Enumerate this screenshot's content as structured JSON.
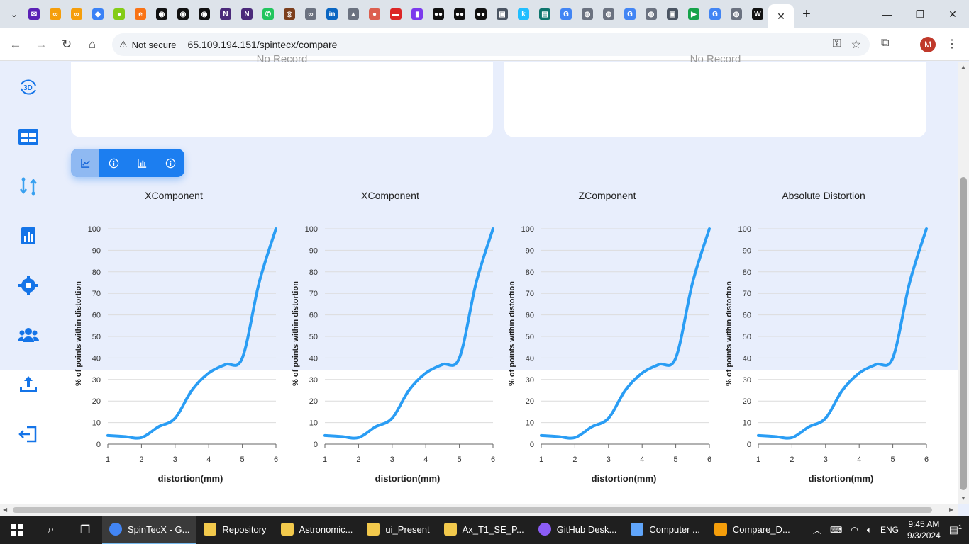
{
  "browser": {
    "tab_favicons": [
      {
        "name": "gmail-icon",
        "color": "#5b21b6",
        "glyph": "✉"
      },
      {
        "name": "infinity-icon",
        "color": "#f59e0b",
        "glyph": "∞"
      },
      {
        "name": "infinity-icon-2",
        "color": "#f59e0b",
        "glyph": "∞"
      },
      {
        "name": "edu-icon",
        "color": "#3b82f6",
        "glyph": "◆"
      },
      {
        "name": "map-pin-icon",
        "color": "#84cc16",
        "glyph": "●"
      },
      {
        "name": "edge-icon",
        "color": "#f97316",
        "glyph": "e"
      },
      {
        "name": "github-icon",
        "color": "#111111",
        "glyph": "◉"
      },
      {
        "name": "github-icon-2",
        "color": "#111111",
        "glyph": "◉"
      },
      {
        "name": "github-icon-3",
        "color": "#111111",
        "glyph": "◉"
      },
      {
        "name": "onenote-icon",
        "color": "#4b2a7a",
        "glyph": "N"
      },
      {
        "name": "onenote-icon-2",
        "color": "#4b2a7a",
        "glyph": "N"
      },
      {
        "name": "whatsapp-icon",
        "color": "#22c55e",
        "glyph": "✆"
      },
      {
        "name": "seal-icon",
        "color": "#7c3f1d",
        "glyph": "◎"
      },
      {
        "name": "link-icon",
        "color": "#6b7280",
        "glyph": "∞"
      },
      {
        "name": "linkedin-icon",
        "color": "#0a66c2",
        "glyph": "in"
      },
      {
        "name": "bird-icon",
        "color": "#6b7280",
        "glyph": "▲"
      },
      {
        "name": "brain-icon",
        "color": "#dc5f4f",
        "glyph": "●"
      },
      {
        "name": "mail-red-icon",
        "color": "#dc2626",
        "glyph": "▬"
      },
      {
        "name": "purple-app-icon",
        "color": "#7c3aed",
        "glyph": "▮"
      },
      {
        "name": "medium-icon",
        "color": "#111111",
        "glyph": "●●"
      },
      {
        "name": "medium-icon-2",
        "color": "#111111",
        "glyph": "●●"
      },
      {
        "name": "medium-icon-3",
        "color": "#111111",
        "glyph": "●●"
      },
      {
        "name": "person-icon",
        "color": "#4b5563",
        "glyph": "▣"
      },
      {
        "name": "kaggle-icon",
        "color": "#20beff",
        "glyph": "k"
      },
      {
        "name": "sheet-icon",
        "color": "#0f766e",
        "glyph": "▤"
      },
      {
        "name": "google-icon",
        "color": "#4285f4",
        "glyph": "G"
      },
      {
        "name": "globe-icon",
        "color": "#6b7280",
        "glyph": "◍"
      },
      {
        "name": "chrome-icon",
        "color": "#6b7280",
        "glyph": "◍"
      },
      {
        "name": "google-icon-2",
        "color": "#4285f4",
        "glyph": "G"
      },
      {
        "name": "globe-icon-2",
        "color": "#6b7280",
        "glyph": "◍"
      },
      {
        "name": "person-icon-2",
        "color": "#4b5563",
        "glyph": "▣"
      },
      {
        "name": "meet-icon",
        "color": "#16a34a",
        "glyph": "▶"
      },
      {
        "name": "google-icon-3",
        "color": "#4285f4",
        "glyph": "G"
      },
      {
        "name": "globe-icon-3",
        "color": "#6b7280",
        "glyph": "◍"
      },
      {
        "name": "wikipedia-icon",
        "color": "#111111",
        "glyph": "W"
      }
    ],
    "address": {
      "security_label": "Not secure",
      "url": "65.109.194.151/spintecx/compare"
    },
    "profile_initial": "M"
  },
  "page": {
    "top_cards": [
      {
        "no_record": "No Record"
      },
      {
        "no_record": "No Record"
      }
    ]
  },
  "chart_data": [
    {
      "type": "line",
      "title": "XComponent",
      "xlabel": "distortion(mm)",
      "ylabel": "% of points within distortion",
      "x": [
        1,
        1.5,
        2,
        2.5,
        3,
        3.5,
        4,
        4.5,
        5,
        5.5,
        6
      ],
      "y": [
        4,
        3.5,
        3,
        8,
        12,
        25,
        33,
        37,
        40,
        75,
        100
      ],
      "xticks": [
        "1",
        "2",
        "3",
        "4",
        "5",
        "6"
      ],
      "yticks": [
        "0",
        "10",
        "20",
        "30",
        "40",
        "50",
        "60",
        "70",
        "80",
        "90",
        "100"
      ],
      "xlim": [
        1,
        6
      ],
      "ylim": [
        0,
        100
      ],
      "grid": true,
      "color": "#2a9df4"
    },
    {
      "type": "line",
      "title": "XComponent",
      "xlabel": "distortion(mm)",
      "ylabel": "% of points within distortion",
      "x": [
        1,
        1.5,
        2,
        2.5,
        3,
        3.5,
        4,
        4.5,
        5,
        5.5,
        6
      ],
      "y": [
        4,
        3.5,
        3,
        8,
        12,
        25,
        33,
        37,
        40,
        75,
        100
      ],
      "xticks": [
        "1",
        "2",
        "3",
        "4",
        "5",
        "6"
      ],
      "yticks": [
        "0",
        "10",
        "20",
        "30",
        "40",
        "50",
        "60",
        "70",
        "80",
        "90",
        "100"
      ],
      "xlim": [
        1,
        6
      ],
      "ylim": [
        0,
        100
      ],
      "grid": true,
      "color": "#2a9df4"
    },
    {
      "type": "line",
      "title": "ZComponent",
      "xlabel": "distortion(mm)",
      "ylabel": "% of points within distortion",
      "x": [
        1,
        1.5,
        2,
        2.5,
        3,
        3.5,
        4,
        4.5,
        5,
        5.5,
        6
      ],
      "y": [
        4,
        3.5,
        3,
        8,
        12,
        25,
        33,
        37,
        40,
        75,
        100
      ],
      "xticks": [
        "1",
        "2",
        "3",
        "4",
        "5",
        "6"
      ],
      "yticks": [
        "0",
        "10",
        "20",
        "30",
        "40",
        "50",
        "60",
        "70",
        "80",
        "90",
        "100"
      ],
      "xlim": [
        1,
        6
      ],
      "ylim": [
        0,
        100
      ],
      "grid": true,
      "color": "#2a9df4"
    },
    {
      "type": "line",
      "title": "Absolute Distortion",
      "xlabel": "distortion(mm)",
      "ylabel": "% of points within distortion",
      "x": [
        1,
        1.5,
        2,
        2.5,
        3,
        3.5,
        4,
        4.5,
        5,
        5.5,
        6
      ],
      "y": [
        4,
        3.5,
        3,
        8,
        12,
        25,
        33,
        37,
        40,
        75,
        100
      ],
      "xticks": [
        "1",
        "2",
        "3",
        "4",
        "5",
        "6"
      ],
      "yticks": [
        "0",
        "10",
        "20",
        "30",
        "40",
        "50",
        "60",
        "70",
        "80",
        "90",
        "100"
      ],
      "xlim": [
        1,
        6
      ],
      "ylim": [
        0,
        100
      ],
      "grid": true,
      "color": "#2a9df4"
    }
  ],
  "taskbar": {
    "apps": [
      {
        "label": "SpinTecX - G...",
        "icon": "chrome-icon",
        "color": "#4285f4",
        "active": true
      },
      {
        "label": "Repository",
        "icon": "folder-icon",
        "color": "#f2c94c",
        "active": false
      },
      {
        "label": "Astronomic...",
        "icon": "folder-icon",
        "color": "#f2c94c",
        "active": false
      },
      {
        "label": "ui_Present",
        "icon": "folder-icon",
        "color": "#f2c94c",
        "active": false
      },
      {
        "label": "Ax_T1_SE_P...",
        "icon": "folder-icon",
        "color": "#f2c94c",
        "active": false
      },
      {
        "label": "GitHub Desk...",
        "icon": "github-desktop-icon",
        "color": "#8b5cf6",
        "active": false
      },
      {
        "label": "Computer ...",
        "icon": "computer-icon",
        "color": "#60a5fa",
        "active": false
      },
      {
        "label": "Compare_D...",
        "icon": "paint-icon",
        "color": "#f59e0b",
        "active": false
      }
    ],
    "tray": {
      "language": "ENG",
      "time": "9:45 AM",
      "date": "9/3/2024",
      "notification_count": "1"
    }
  }
}
